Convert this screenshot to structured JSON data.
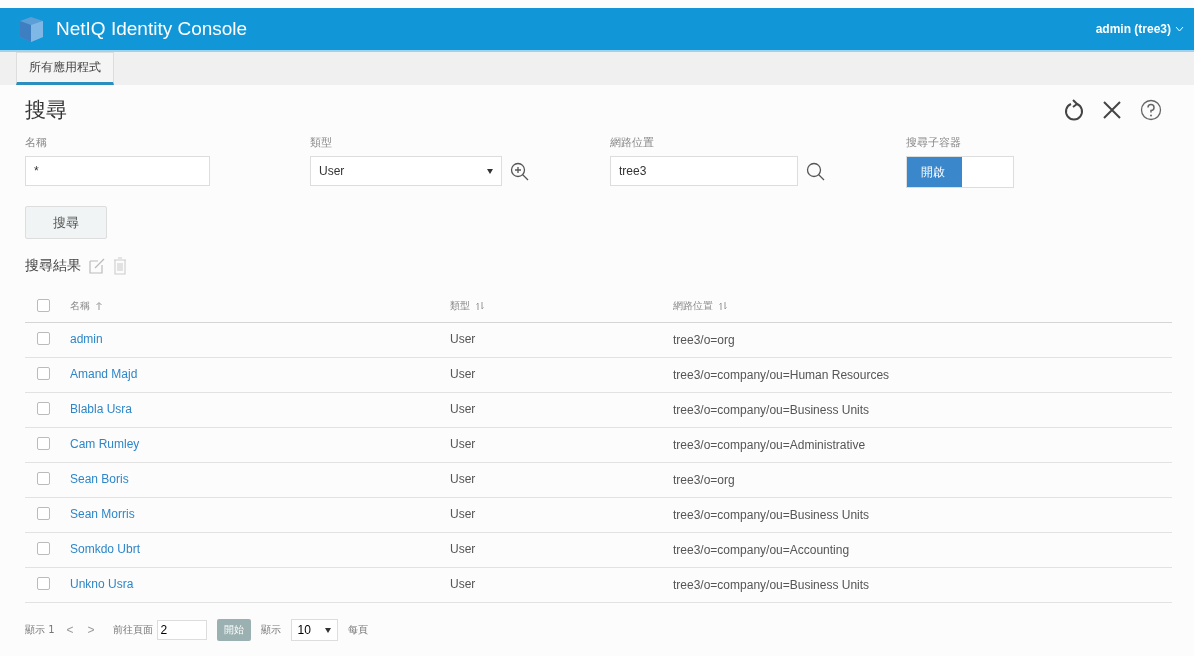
{
  "header": {
    "title": "NetIQ Identity Console",
    "user": "admin (tree3)"
  },
  "tabs": [
    {
      "label": "所有應用程式",
      "selected": true
    }
  ],
  "page": {
    "title": "搜尋"
  },
  "form": {
    "name": {
      "label": "名稱",
      "value": "*"
    },
    "type": {
      "label": "類型",
      "value": "User"
    },
    "location": {
      "label": "網路位置",
      "value": "tree3"
    },
    "subcontainers": {
      "label": "搜尋子容器",
      "on_label": "開啟",
      "on": true
    },
    "search_button": "搜尋"
  },
  "results": {
    "title": "搜尋結果",
    "select_all_checked": false,
    "columns": [
      {
        "label": "名稱",
        "kind": "sorted"
      },
      {
        "label": "類型",
        "kind": "sortable"
      },
      {
        "label": "網路位置",
        "kind": "sortable"
      }
    ],
    "rows": [
      {
        "name": "admin",
        "type": "User",
        "location": "tree3/o=org",
        "checked": false
      },
      {
        "name": "Amand Majd",
        "type": "User",
        "location": "tree3/o=company/ou=Human Resources",
        "checked": false
      },
      {
        "name": "Blabla Usra",
        "type": "User",
        "location": "tree3/o=company/ou=Business Units",
        "checked": false
      },
      {
        "name": "Cam Rumley",
        "type": "User",
        "location": "tree3/o=company/ou=Administrative",
        "checked": false
      },
      {
        "name": "Sean Boris",
        "type": "User",
        "location": "tree3/o=org",
        "checked": false
      },
      {
        "name": "Sean Morris",
        "type": "User",
        "location": "tree3/o=company/ou=Business Units",
        "checked": false
      },
      {
        "name": "Somkdo Ubrt",
        "type": "User",
        "location": "tree3/o=company/ou=Accounting",
        "checked": false
      },
      {
        "name": "Unkno Usra",
        "type": "User",
        "location": "tree3/o=company/ou=Business Units",
        "checked": false
      }
    ]
  },
  "pagination": {
    "showing": "顯示 1",
    "prev": "<",
    "next": ">",
    "goto_label": "前往頁面",
    "goto_value": "2",
    "go_button": "開始",
    "show_label": "顯示",
    "page_size": "10",
    "per_page": "每頁"
  }
}
